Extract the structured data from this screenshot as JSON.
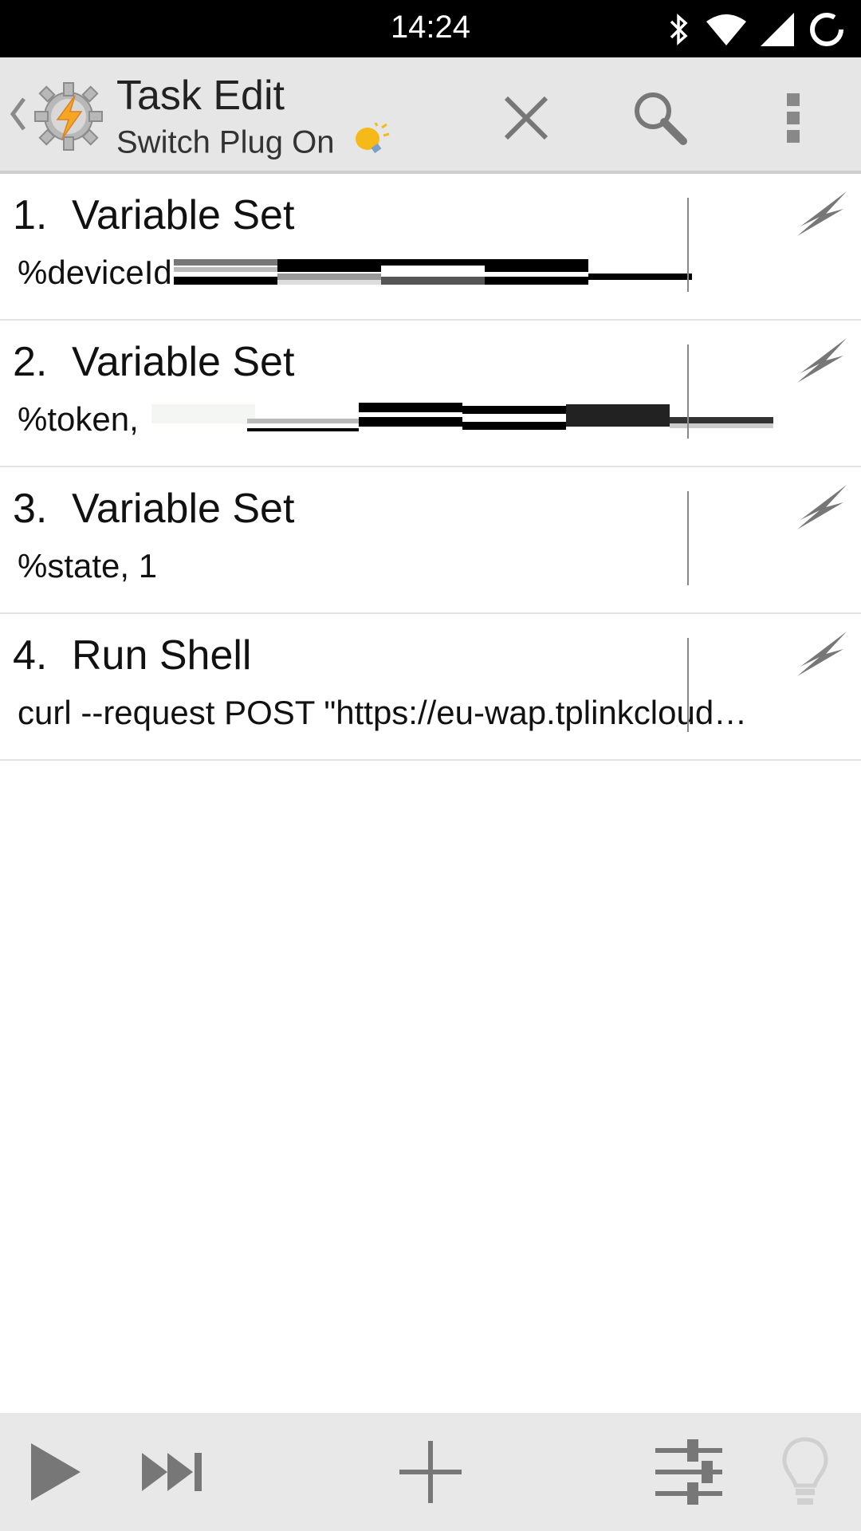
{
  "status_bar": {
    "time": "14:24",
    "icons": [
      "bluetooth-icon",
      "wifi-icon",
      "cell-signal-icon",
      "sync-circle-icon"
    ]
  },
  "action_bar": {
    "title": "Task Edit",
    "subtitle": "Switch Plug On",
    "icons": [
      "back-caret-icon",
      "tasker-app-icon",
      "lightbulb-icon",
      "close-icon",
      "search-icon",
      "overflow-menu-icon"
    ]
  },
  "actions": [
    {
      "number": "1.",
      "name": "Variable Set",
      "arg": "%deviceId"
    },
    {
      "number": "2.",
      "name": "Variable Set",
      "arg": "%token,"
    },
    {
      "number": "3.",
      "name": "Variable Set",
      "arg": "%state,  1"
    },
    {
      "number": "4.",
      "name": "Run Shell",
      "arg": "curl --request POST \"https://eu-wap.tplinkcloud…"
    }
  ],
  "bottom_bar": {
    "icons": [
      "play-icon",
      "step-forward-icon",
      "add-icon",
      "sliders-icon",
      "lightbulb-outline-icon"
    ]
  },
  "colors": {
    "status_bar_bg": "#000000",
    "action_bar_bg": "#e6e6e6",
    "bottom_bar_bg": "#e8e8e8",
    "bolt_gray": "#777777",
    "tasker_orange": "#f5a623"
  }
}
